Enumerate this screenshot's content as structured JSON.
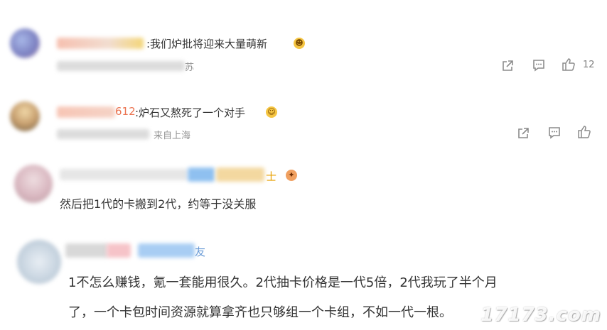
{
  "comments": [
    {
      "name_visible": "",
      "text": ":我们炉批将迎来大量萌新",
      "meta_visible": "苏",
      "like_count": "12"
    },
    {
      "name_visible": "612",
      "text": ":炉石又熬死了一个对手",
      "meta_visible": "来自上海",
      "like_count": ""
    },
    {
      "name_visible": "士",
      "text": "然后把1代的卡搬到2代，约等于没关服"
    },
    {
      "name_visible": "友",
      "text_line1": "1不怎么赚钱，氪一套能用很久。2代抽卡价格是一代5倍，2代我玩了半个月",
      "text_line2": "了，一个卡包时间资源就算拿齐也只够组一个卡组，不如一代一根。"
    }
  ],
  "icons": [
    "share-icon",
    "comment-icon",
    "like-icon"
  ],
  "watermark": "17173.com"
}
